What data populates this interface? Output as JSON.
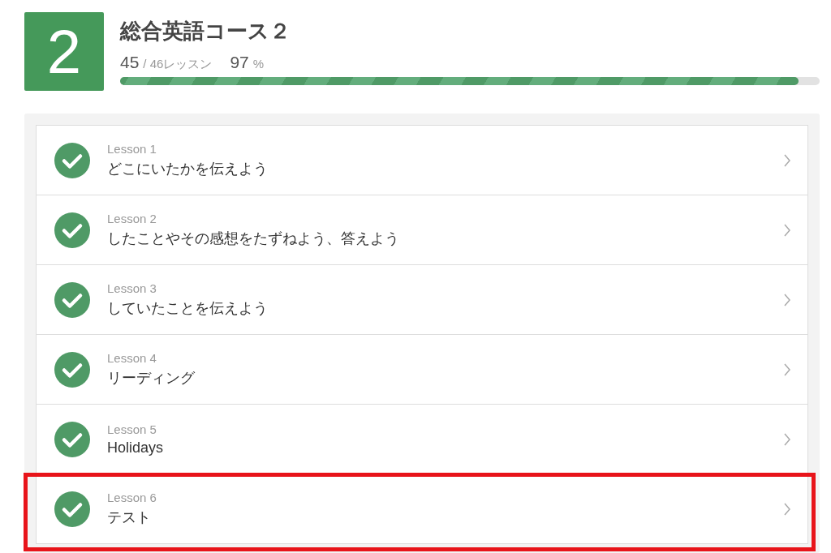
{
  "course": {
    "badge": "2",
    "title": "総合英語コース２",
    "done": "45",
    "total": "/ 46レッスン",
    "percent": "97",
    "percent_unit": "%",
    "level": 0.97
  },
  "lessons": [
    {
      "number": "Lesson 1",
      "title": "どこにいたかを伝えよう",
      "completed": true,
      "highlighted": false
    },
    {
      "number": "Lesson 2",
      "title": "したことやその感想をたずねよう、答えよう",
      "completed": true,
      "highlighted": false
    },
    {
      "number": "Lesson 3",
      "title": "していたことを伝えよう",
      "completed": true,
      "highlighted": false
    },
    {
      "number": "Lesson 4",
      "title": "リーディング",
      "completed": true,
      "highlighted": false
    },
    {
      "number": "Lesson 5",
      "title": "Holidays",
      "completed": true,
      "highlighted": false
    },
    {
      "number": "Lesson 6",
      "title": "テスト",
      "completed": true,
      "highlighted": true
    }
  ]
}
